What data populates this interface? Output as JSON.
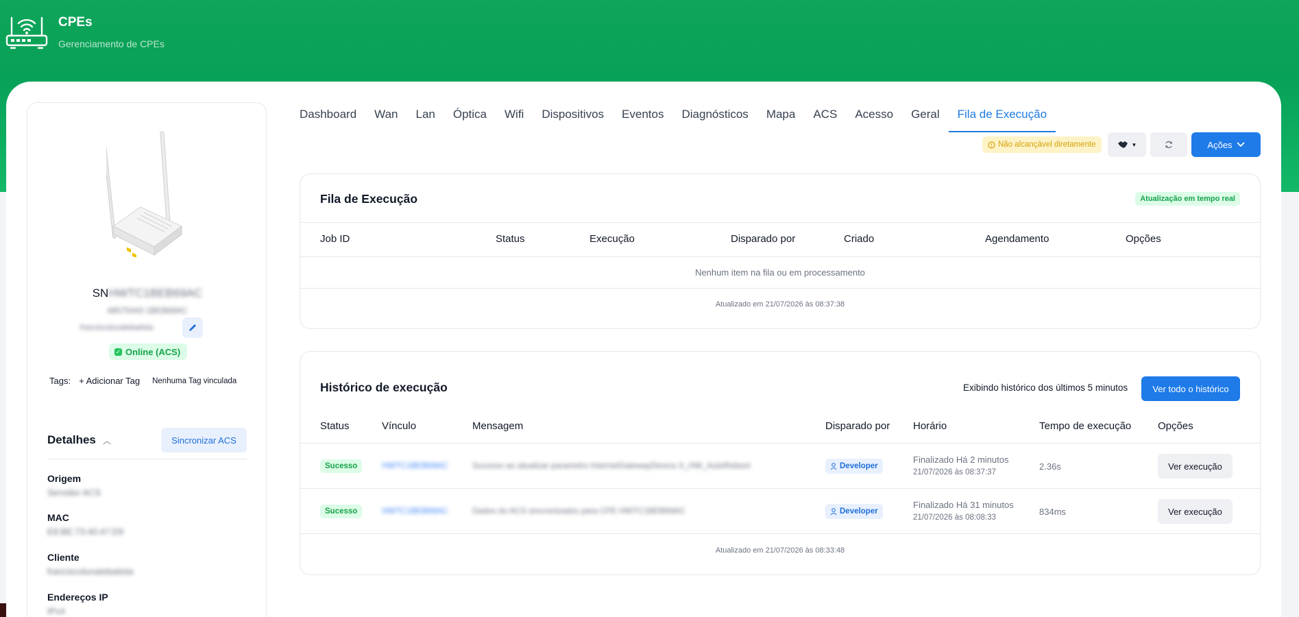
{
  "header": {
    "title": "CPEs",
    "subtitle": "Gerenciamento de CPEs"
  },
  "device": {
    "sn_prefix": "SN",
    "sn_value": "HWTC1BEB69AC",
    "sub_id": "48575443 1BEB69AC",
    "username": "franciscolunatebatista",
    "status": "Online (ACS)",
    "tags_label": "Tags:",
    "add_tag": "+ Adicionar Tag",
    "no_tag": "Nenhuma Tag vinculada"
  },
  "details": {
    "title": "Detalhes",
    "sync_label": "Sincronizar ACS",
    "fields": [
      {
        "label": "Origem",
        "value": "Servidor ACS"
      },
      {
        "label": "MAC",
        "value": "E8:BE:73:40:47:D9"
      },
      {
        "label": "Cliente",
        "value": "franciscolunatebatista"
      },
      {
        "label": "Endereços IP",
        "value": "IPv4"
      }
    ]
  },
  "tabs": [
    {
      "label": "Dashboard",
      "active": false
    },
    {
      "label": "Wan",
      "active": false
    },
    {
      "label": "Lan",
      "active": false
    },
    {
      "label": "Óptica",
      "active": false
    },
    {
      "label": "Wifi",
      "active": false
    },
    {
      "label": "Dispositivos",
      "active": false
    },
    {
      "label": "Eventos",
      "active": false
    },
    {
      "label": "Diagnósticos",
      "active": false
    },
    {
      "label": "Mapa",
      "active": false
    },
    {
      "label": "ACS",
      "active": false
    },
    {
      "label": "Acesso",
      "active": false
    },
    {
      "label": "Geral",
      "active": false
    },
    {
      "label": "Fila de Execução",
      "active": true
    }
  ],
  "toolbar": {
    "reach_status": "Não alcançável diretamente",
    "actions_label": "Ações"
  },
  "queue": {
    "title": "Fila de Execução",
    "realtime": "Atualização em tempo real",
    "columns": [
      "Job ID",
      "Status",
      "Execução",
      "Disparado por",
      "Criado",
      "Agendamento",
      "Opções"
    ],
    "empty": "Nenhum item na fila ou em processamento",
    "updated": "Atualizado em 21/07/2026 às 08:37:38"
  },
  "history": {
    "title": "Histórico de execução",
    "info": "Exibindo histórico dos últimos 5 minutos",
    "view_all": "Ver todo o histórico",
    "columns": [
      "Status",
      "Vínculo",
      "Mensagem",
      "Disparado por",
      "Horário",
      "Tempo de execução",
      "Opções"
    ],
    "rows": [
      {
        "status": "Sucesso",
        "link": "HWTC1BEB69AC",
        "message": "Sucesso ao atualizar parametro InternetGatewayDevice.X_HW_AutoReboot",
        "by": "Developer",
        "time_main": "Finalizado Há 2 minutos",
        "time_sub": "21/07/2026 às 08:37:37",
        "duration": "2.36s",
        "action": "Ver execução"
      },
      {
        "status": "Sucesso",
        "link": "HWTC1BEB69AC",
        "message": "Dados do ACS sincronizados para CPE HWTC1BEB69AC",
        "by": "Developer",
        "time_main": "Finalizado Há 31 minutos",
        "time_sub": "21/07/2026 às 08:08:33",
        "duration": "834ms",
        "action": "Ver execução"
      }
    ],
    "updated": "Atualizado em 21/07/2026 às 08:33:48"
  },
  "colors": {
    "brand_green": "#07a157",
    "accent_blue": "#1e7be8",
    "success_green": "#16a34a",
    "warning_yellow": "#d4a106"
  }
}
